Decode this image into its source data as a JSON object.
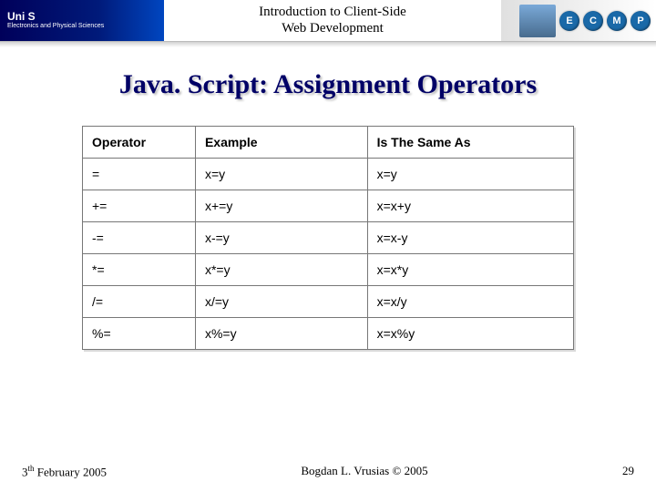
{
  "header": {
    "logo_main": "Uni S",
    "logo_sub": "Electronics and Physical Sciences",
    "title_line1": "Introduction to Client-Side",
    "title_line2": "Web Development",
    "badges": [
      "E",
      "C",
      "M",
      "P"
    ]
  },
  "slide_title": "Java. Script: Assignment Operators",
  "table": {
    "headers": [
      "Operator",
      "Example",
      "Is The Same As"
    ],
    "rows": [
      {
        "operator": "=",
        "example": "x=y",
        "same": "x=y"
      },
      {
        "operator": "+=",
        "example": "x+=y",
        "same": "x=x+y"
      },
      {
        "operator": "-=",
        "example": "x-=y",
        "same": "x=x-y"
      },
      {
        "operator": "*=",
        "example": "x*=y",
        "same": "x=x*y"
      },
      {
        "operator": "/=",
        "example": "x/=y",
        "same": "x=x/y"
      },
      {
        "operator": "%=",
        "example": "x%=y",
        "same": "x=x%y"
      }
    ]
  },
  "footer": {
    "date_prefix": "3",
    "date_sup": "th",
    "date_rest": " February 2005",
    "center": "Bogdan L. Vrusias © 2005",
    "page": "29"
  }
}
